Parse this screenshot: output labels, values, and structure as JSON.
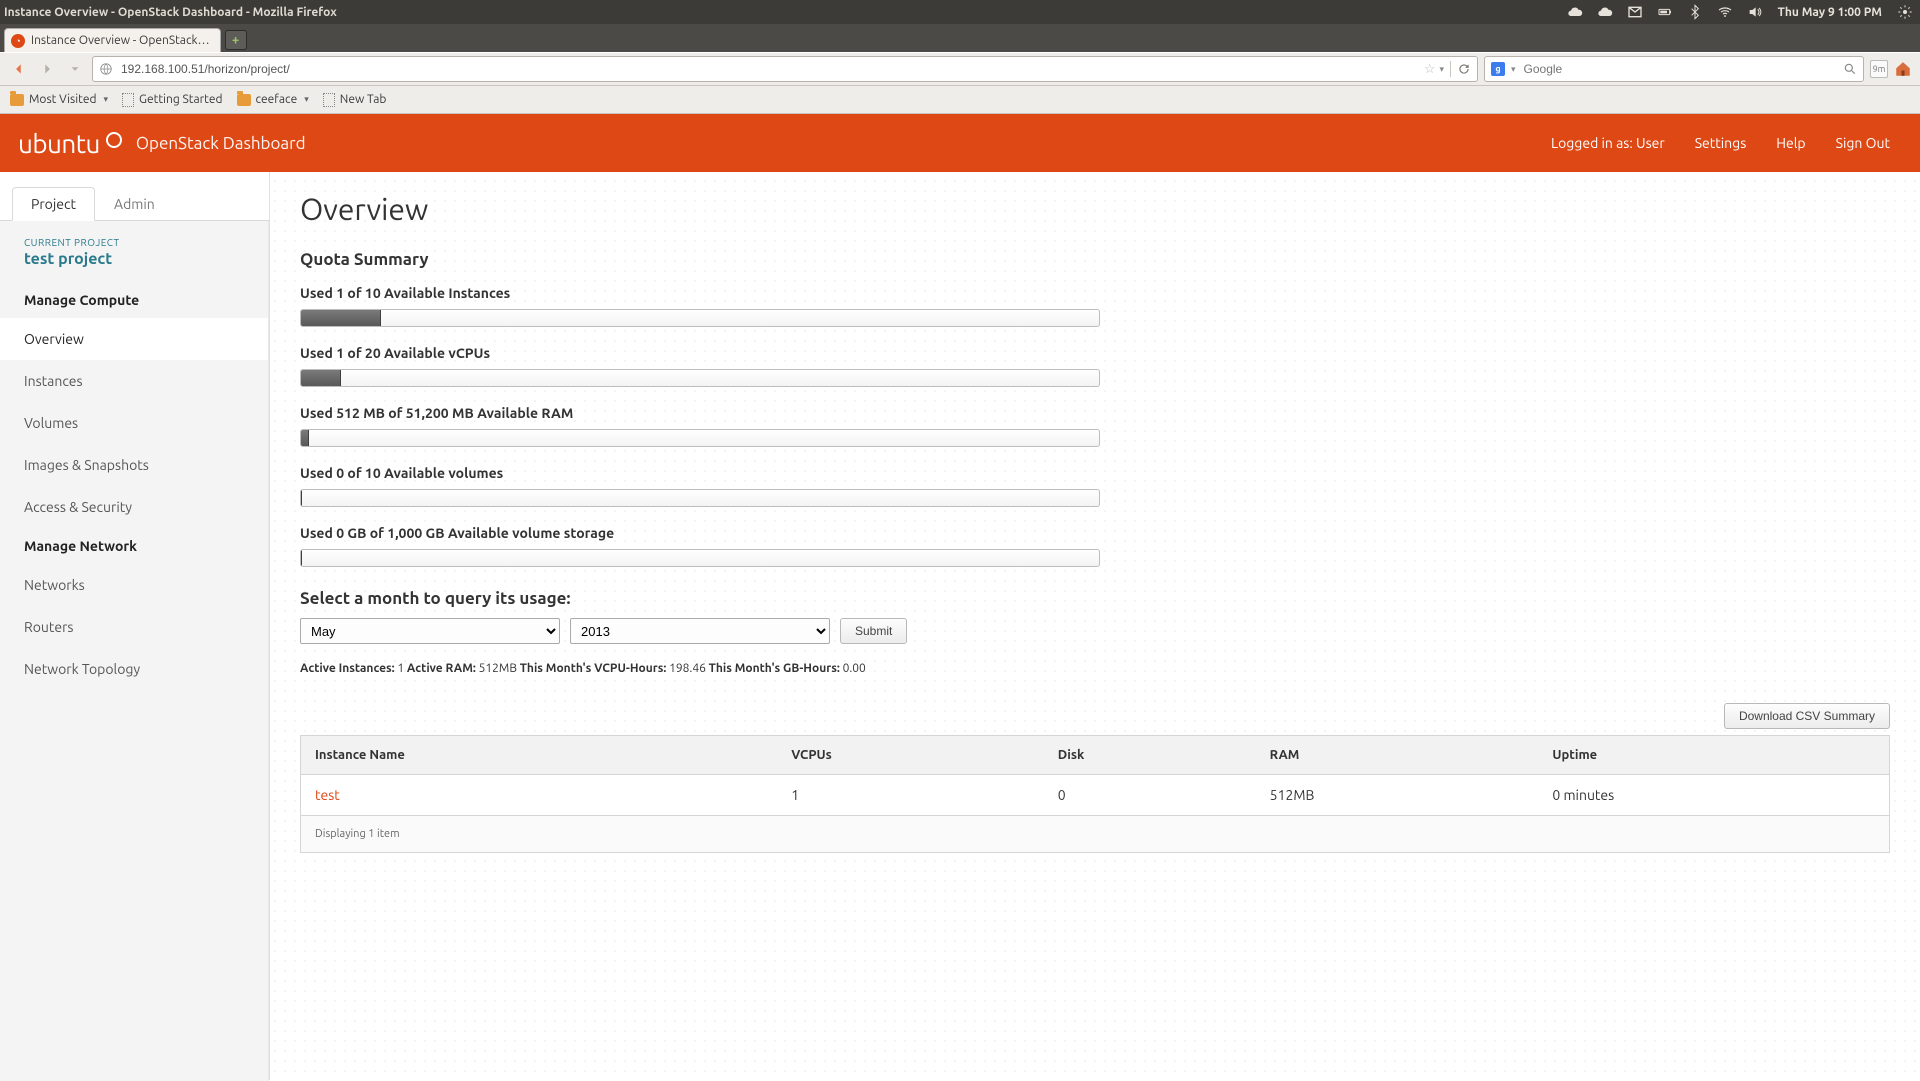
{
  "menubar": {
    "window_title": "Instance Overview - OpenStack Dashboard - Mozilla Firefox",
    "clock": "Thu May 9  1:00 PM"
  },
  "firefox": {
    "tab_title": "Instance Overview - OpenStack…",
    "url": "192.168.100.51/horizon/project/",
    "search_placeholder": "Google",
    "bookmarks": {
      "most_visited": "Most Visited",
      "getting_started": "Getting Started",
      "ceeface": "ceeface",
      "new_tab": "New Tab"
    },
    "sync_badge": "9m"
  },
  "header": {
    "brand": "ubuntu",
    "subtitle": "OpenStack Dashboard",
    "logged_in": "Logged in as: User",
    "settings": "Settings",
    "help": "Help",
    "sign_out": "Sign Out"
  },
  "tabs": {
    "project": "Project",
    "admin": "Admin"
  },
  "sidebar": {
    "label": "CURRENT PROJECT",
    "project": "test project",
    "section_compute": "Manage Compute",
    "nav_compute": {
      "overview": "Overview",
      "instances": "Instances",
      "volumes": "Volumes",
      "images": "Images & Snapshots",
      "access": "Access & Security"
    },
    "section_network": "Manage Network",
    "nav_network": {
      "networks": "Networks",
      "routers": "Routers",
      "topology": "Network Topology"
    }
  },
  "page": {
    "title": "Overview",
    "quota_title": "Quota Summary",
    "quotas": {
      "instances": {
        "label": "Used 1 of 10 Available Instances",
        "pct": 10
      },
      "vcpus": {
        "label": "Used 1 of 20 Available vCPUs",
        "pct": 5
      },
      "ram": {
        "label": "Used 512 MB of 51,200 MB Available RAM",
        "pct": 1
      },
      "volumes": {
        "label": "Used 0 of 10 Available volumes",
        "pct": 0
      },
      "storage": {
        "label": "Used 0 GB of 1,000 GB Available volume storage",
        "pct": 0
      }
    },
    "month_title": "Select a month to query its usage:",
    "month_select": "May",
    "year_select": "2013",
    "submit": "Submit",
    "stats": {
      "active_instances_label": "Active Instances:",
      "active_instances": "1",
      "active_ram_label": "Active RAM:",
      "active_ram": "512MB",
      "vcpu_hours_label": "This Month's VCPU-Hours:",
      "vcpu_hours": "198.46",
      "gb_hours_label": "This Month's GB-Hours:",
      "gb_hours": "0.00"
    },
    "csv_button": "Download CSV Summary",
    "table": {
      "headers": {
        "name": "Instance Name",
        "vcpus": "VCPUs",
        "disk": "Disk",
        "ram": "RAM",
        "uptime": "Uptime"
      },
      "rows": [
        {
          "name": "test",
          "vcpus": "1",
          "disk": "0",
          "ram": "512MB",
          "uptime": "0 minutes"
        }
      ],
      "footer": "Displaying 1 item"
    }
  }
}
